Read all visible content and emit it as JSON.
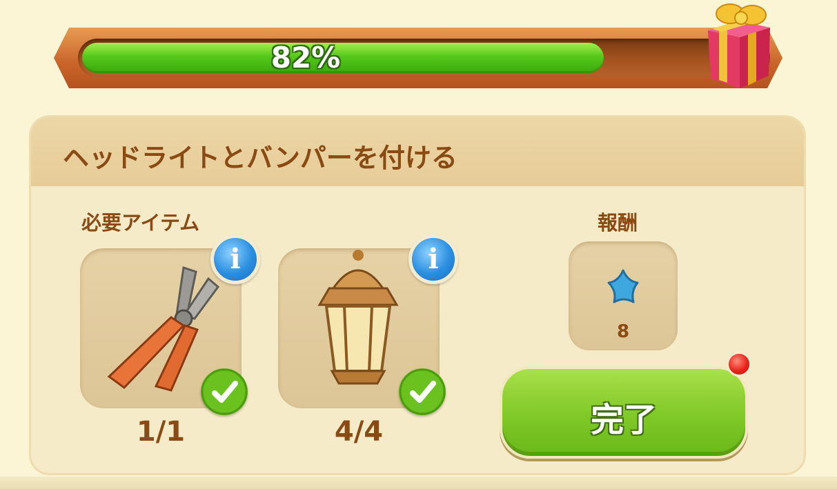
{
  "progress": {
    "value": 0.82,
    "label": "82%"
  },
  "task": {
    "title": "ヘッドライトとバンパーを付ける",
    "required_items_label": "必要アイテム",
    "reward_label": "報酬",
    "items": [
      {
        "icon": "pliers-icon",
        "count": "1/1",
        "complete": true
      },
      {
        "icon": "lantern-icon",
        "count": "4/4",
        "complete": true
      }
    ],
    "reward": {
      "icon": "blue-star-icon",
      "amount": "8"
    },
    "complete_button_label": "完了"
  },
  "colors": {
    "progress_green": "#56c81a",
    "text_brown": "#8a4a13",
    "info_blue": "#2b8fe0",
    "check_green": "#6bc21f",
    "button_green": "#7fc827",
    "notification_red": "#e8251b",
    "star_blue": "#3ea7dd"
  }
}
